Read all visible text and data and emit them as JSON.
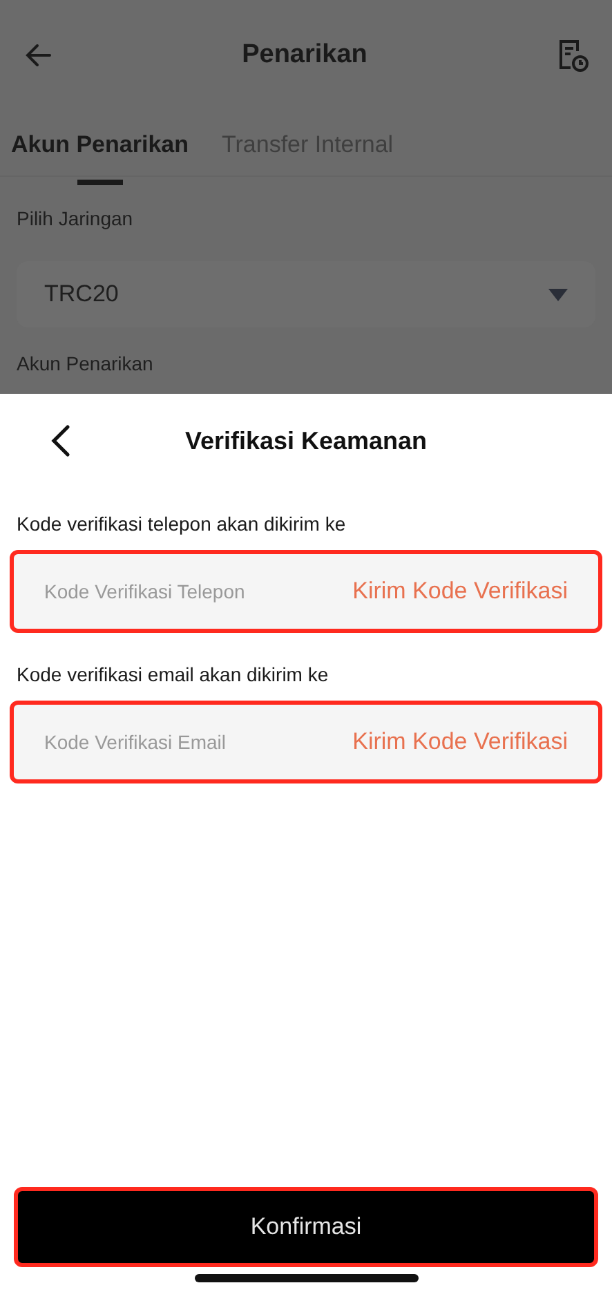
{
  "header": {
    "title": "Penarikan"
  },
  "tabs": [
    {
      "label": "Akun Penarikan",
      "selected": true
    },
    {
      "label": "Transfer Internal",
      "selected": false
    }
  ],
  "network": {
    "label": "Pilih Jaringan",
    "value": "TRC20"
  },
  "account": {
    "label": "Akun Penarikan"
  },
  "sheet": {
    "title": "Verifikasi Keamanan",
    "fields": [
      {
        "label": "Kode verifikasi telepon akan dikirim ke",
        "placeholder": "Kode Verifikasi Telepon",
        "action": "Kirim Kode Verifikasi",
        "highlighted": true
      },
      {
        "label": "Kode verifikasi email akan dikirim ke",
        "placeholder": "Kode Verifikasi Email",
        "action": "Kirim Kode Verifikasi",
        "highlighted": true
      }
    ],
    "confirm": {
      "label": "Konfirmasi",
      "highlighted": true
    }
  }
}
